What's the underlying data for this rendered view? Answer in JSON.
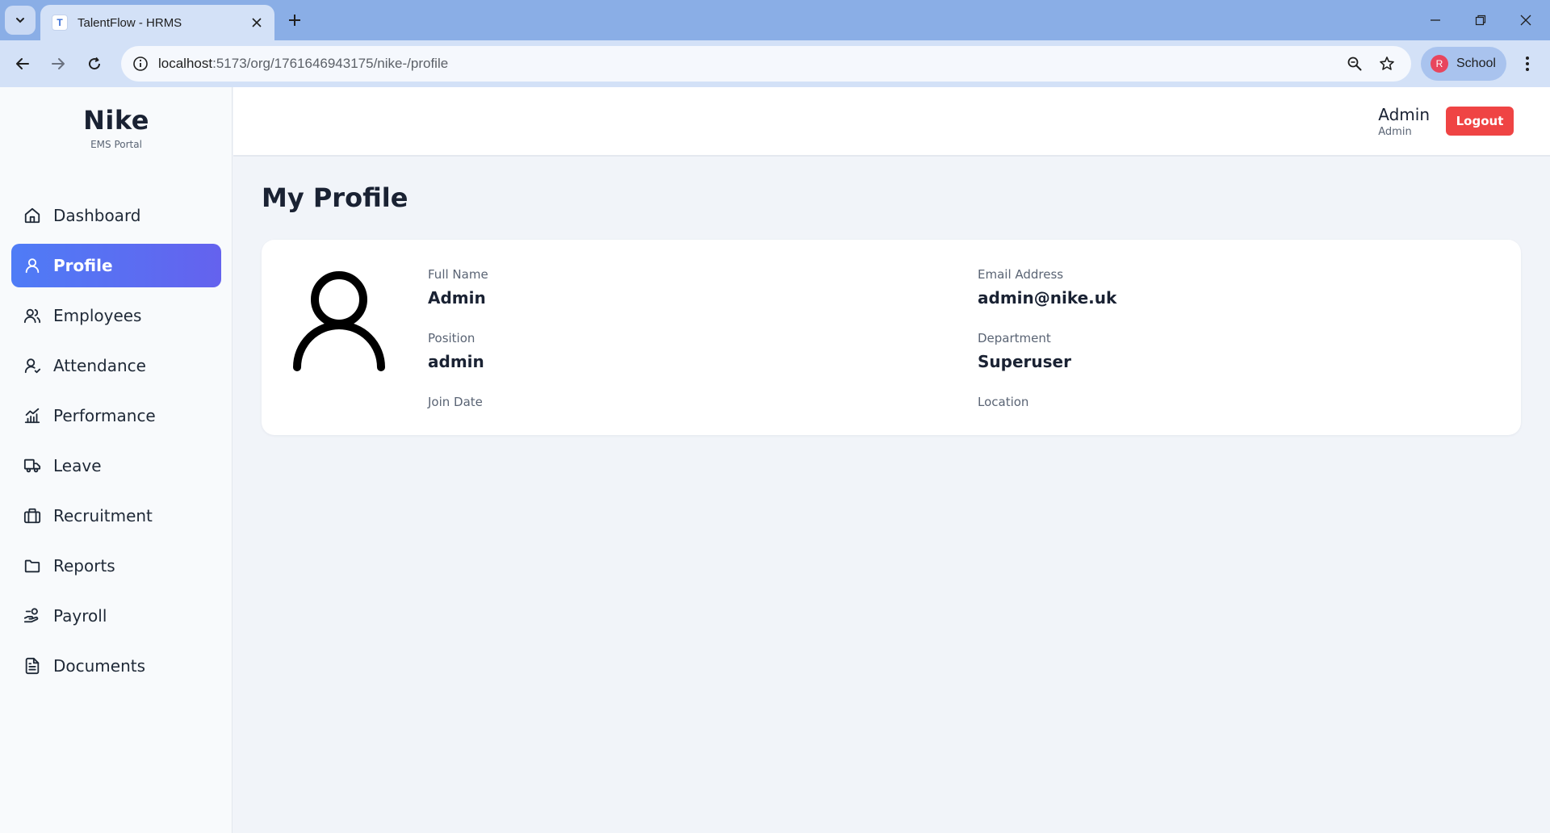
{
  "browser": {
    "tab_title": "TalentFlow - HRMS",
    "tab_favicon_letter": "T",
    "url_host": "localhost",
    "url_path": ":5173/org/1761646943175/nike-/profile",
    "profile_initial": "R",
    "profile_label": "School"
  },
  "brand": {
    "name": "Nike",
    "subtitle": "EMS Portal"
  },
  "sidebar": {
    "items": [
      {
        "label": "Dashboard",
        "icon": "home-icon",
        "active": false
      },
      {
        "label": "Profile",
        "icon": "user-icon",
        "active": true
      },
      {
        "label": "Employees",
        "icon": "users-icon",
        "active": false
      },
      {
        "label": "Attendance",
        "icon": "user-check-icon",
        "active": false
      },
      {
        "label": "Performance",
        "icon": "chart-icon",
        "active": false
      },
      {
        "label": "Leave",
        "icon": "truck-icon",
        "active": false
      },
      {
        "label": "Recruitment",
        "icon": "briefcase-icon",
        "active": false
      },
      {
        "label": "Reports",
        "icon": "folder-icon",
        "active": false
      },
      {
        "label": "Payroll",
        "icon": "hand-coins-icon",
        "active": false
      },
      {
        "label": "Documents",
        "icon": "document-icon",
        "active": false
      }
    ]
  },
  "header": {
    "user_name": "Admin",
    "user_role": "Admin",
    "logout_label": "Logout"
  },
  "page": {
    "title": "My Profile"
  },
  "profile": {
    "full_name_label": "Full Name",
    "full_name": "Admin",
    "email_label": "Email Address",
    "email": "admin@nike.uk",
    "position_label": "Position",
    "position": "admin",
    "department_label": "Department",
    "department": "Superuser",
    "join_date_label": "Join Date",
    "join_date": "",
    "location_label": "Location",
    "location": ""
  },
  "colors": {
    "accent_start": "#4f7cf6",
    "accent_end": "#6462ee",
    "logout": "#ef4444",
    "browser_frame": "#8aaee6"
  }
}
